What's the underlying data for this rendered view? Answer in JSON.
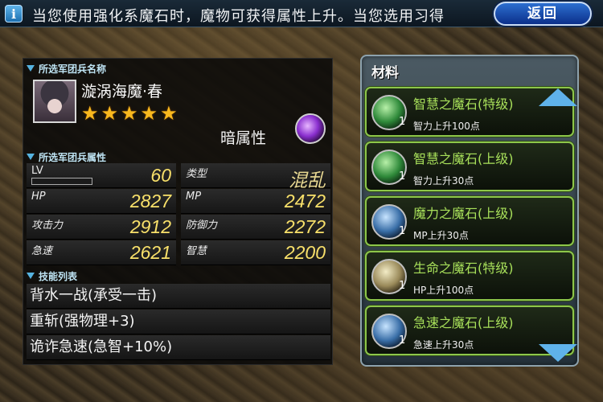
{
  "ticker": {
    "icon": "info-icon",
    "text": "当您使用强化系魔石时，魔物可获得属性上升。当您选用习得"
  },
  "back_button": "返回",
  "unit": {
    "section_name": "所选军团兵名称",
    "name": "漩涡海魔·春",
    "stars": [
      "★",
      "★",
      "★",
      "★",
      "★"
    ],
    "element": "暗属性",
    "element_color": "#8a2fcf"
  },
  "stats": {
    "section": "所选军团兵属性",
    "lv_label": "LV",
    "lv_value": "60",
    "type_label": "类型",
    "type_value": "混乱",
    "hp_label": "HP",
    "hp_value": "2827",
    "mp_label": "MP",
    "mp_value": "2472",
    "atk_label": "攻击力",
    "atk_value": "2912",
    "def_label": "防御力",
    "def_value": "2272",
    "spd_label": "急速",
    "spd_value": "2621",
    "int_label": "智慧",
    "int_value": "2200"
  },
  "skills": {
    "section": "技能列表",
    "items": [
      "背水一战(承受一击)",
      "重斩(强物理+3)",
      "诡诈急速(急智+10%)"
    ]
  },
  "materials": {
    "title": "材料",
    "items": [
      {
        "name": "智慧之魔石(特级)",
        "qty": "1",
        "effect": "智力上升100点",
        "color": "#2f8a3a"
      },
      {
        "name": "智慧之魔石(上级)",
        "qty": "1",
        "effect": "智力上升30点",
        "color": "#2f8a3a"
      },
      {
        "name": "魔力之魔石(上级)",
        "qty": "1",
        "effect": "MP上升30点",
        "color": "#3a6fa8"
      },
      {
        "name": "生命之魔石(特级)",
        "qty": "1",
        "effect": "HP上升100点",
        "color": "#9a8a5a"
      },
      {
        "name": "急速之魔石(上级)",
        "qty": "1",
        "effect": "急速上升30点",
        "color": "#3a6fa8"
      }
    ]
  }
}
